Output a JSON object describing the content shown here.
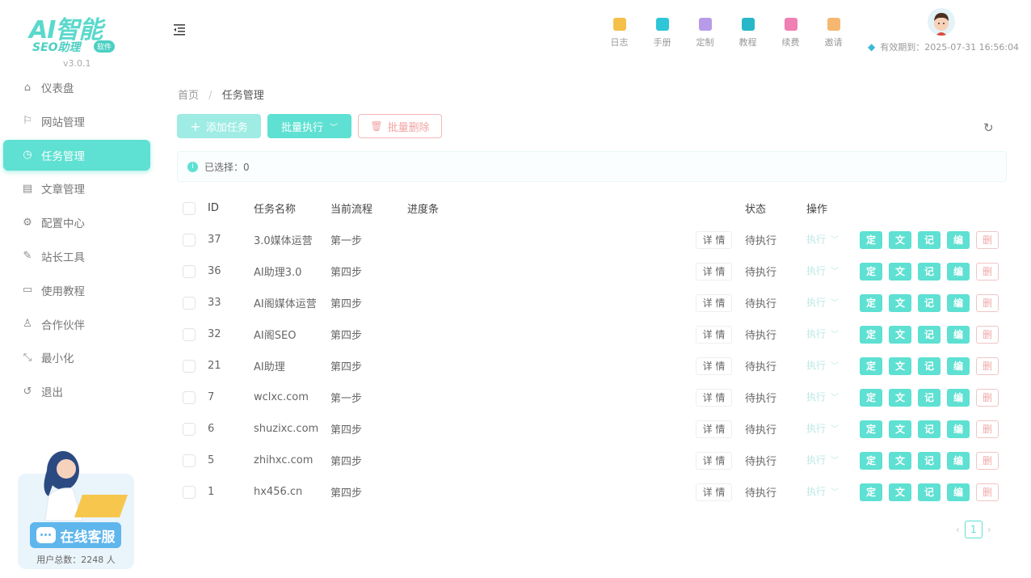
{
  "app": {
    "logo_main": "AI智能",
    "logo_sub": "SEO助理",
    "logo_badge": "软件",
    "version": "v3.0.1"
  },
  "sidebar": {
    "items": [
      {
        "label": "仪表盘",
        "icon": "home-icon",
        "glyph": "⌂",
        "active": false
      },
      {
        "label": "网站管理",
        "icon": "flag-icon",
        "glyph": "⚐",
        "active": false
      },
      {
        "label": "任务管理",
        "icon": "clock-icon",
        "glyph": "◷",
        "active": true
      },
      {
        "label": "文章管理",
        "icon": "document-icon",
        "glyph": "▤",
        "active": false
      },
      {
        "label": "配置中心",
        "icon": "gear-icon",
        "glyph": "⚙",
        "active": false
      },
      {
        "label": "站长工具",
        "icon": "wrench-icon",
        "glyph": "✎",
        "active": false
      },
      {
        "label": "使用教程",
        "icon": "monitor-icon",
        "glyph": "▭",
        "active": false
      },
      {
        "label": "合作伙伴",
        "icon": "partner-icon",
        "glyph": "♙",
        "active": false
      },
      {
        "label": "最小化",
        "icon": "minimize-icon",
        "glyph": "⤡",
        "active": false
      },
      {
        "label": "退出",
        "icon": "logout-icon",
        "glyph": "↺",
        "active": false
      }
    ]
  },
  "service": {
    "button_label": "在线客服",
    "user_count": "用户总数：2248 人"
  },
  "header": {
    "icons": [
      {
        "label": "日志",
        "icon": "log-icon",
        "color": "#f5c04a"
      },
      {
        "label": "手册",
        "icon": "manual-icon",
        "color": "#2fc6d8"
      },
      {
        "label": "定制",
        "icon": "custom-icon",
        "color": "#b79be8"
      },
      {
        "label": "教程",
        "icon": "tutorial-icon",
        "color": "#27b7c8"
      },
      {
        "label": "续费",
        "icon": "renew-icon",
        "color": "#f07fb3"
      },
      {
        "label": "邀请",
        "icon": "invite-icon",
        "color": "#f6b870"
      }
    ],
    "expiry": "有效期到：2025-07-31 16:56:04"
  },
  "breadcrumb": {
    "home": "首页",
    "separator": "/",
    "current": "任务管理"
  },
  "toolbar": {
    "add_label": "添加任务",
    "batch_label": "批量执行",
    "delete_label": "批量删除"
  },
  "selection": {
    "text": "已选择：0"
  },
  "table": {
    "headers": {
      "id": "ID",
      "name": "任务名称",
      "flow": "当前流程",
      "progress": "进度条",
      "status": "状态",
      "actions": "操作"
    },
    "detail_label": "详 情",
    "exec_label": "执行",
    "action_labels": [
      "定",
      "文",
      "记",
      "编",
      "删"
    ],
    "rows": [
      {
        "id": "37",
        "name": "3.0媒体运营",
        "flow": "第一步",
        "status": "待执行"
      },
      {
        "id": "36",
        "name": "AI助理3.0",
        "flow": "第四步",
        "status": "待执行"
      },
      {
        "id": "33",
        "name": "AI阁媒体运营",
        "flow": "第四步",
        "status": "待执行"
      },
      {
        "id": "32",
        "name": "AI阁SEO",
        "flow": "第四步",
        "status": "待执行"
      },
      {
        "id": "21",
        "name": "AI助理",
        "flow": "第四步",
        "status": "待执行"
      },
      {
        "id": "7",
        "name": "wclxc.com",
        "flow": "第一步",
        "status": "待执行"
      },
      {
        "id": "6",
        "name": "shuzixc.com",
        "flow": "第四步",
        "status": "待执行"
      },
      {
        "id": "5",
        "name": "zhihxc.com",
        "flow": "第四步",
        "status": "待执行"
      },
      {
        "id": "1",
        "name": "hx456.cn",
        "flow": "第四步",
        "status": "待执行"
      }
    ]
  },
  "pagination": {
    "current_page": "1",
    "prev": "‹",
    "next": "›"
  },
  "colors": {
    "accent": "#5ee0d2",
    "danger": "#f3a3a3"
  }
}
